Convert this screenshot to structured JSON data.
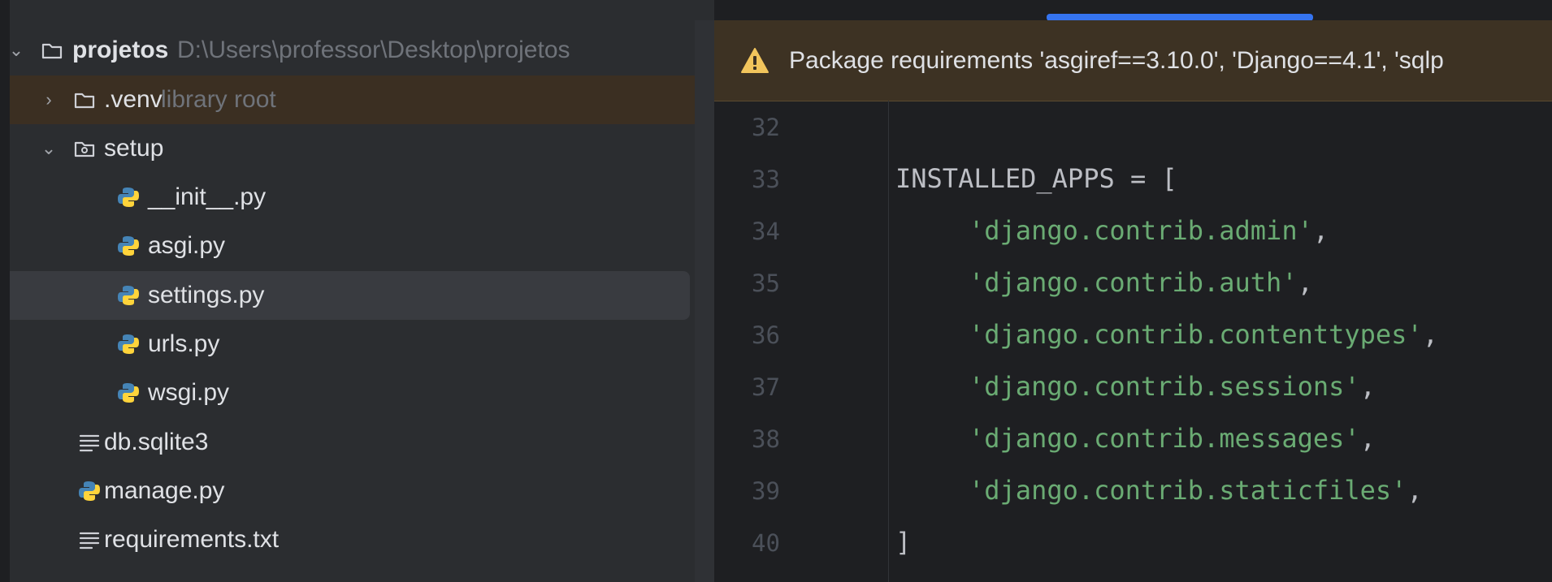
{
  "project": {
    "root": {
      "name": "projetos",
      "path": "D:\\Users\\professor\\Desktop\\projetos"
    },
    "venv": {
      "name": ".venv",
      "hint": "library root"
    },
    "setup": {
      "name": "setup",
      "files": [
        "__init__.py",
        "asgi.py",
        "settings.py",
        "urls.py",
        "wsgi.py"
      ]
    },
    "root_files": [
      "db.sqlite3",
      "manage.py",
      "requirements.txt"
    ],
    "selected": "settings.py"
  },
  "banner": {
    "message": "Package requirements 'asgiref==3.10.0', 'Django==4.1', 'sqlp"
  },
  "editor": {
    "lines": [
      {
        "n": "32",
        "code": ""
      },
      {
        "n": "33",
        "code": "INSTALLED_APPS = ["
      },
      {
        "n": "34",
        "str": "'django.contrib.admin'",
        "tail": ","
      },
      {
        "n": "35",
        "str": "'django.contrib.auth'",
        "tail": ","
      },
      {
        "n": "36",
        "str": "'django.contrib.contenttypes'",
        "tail": ","
      },
      {
        "n": "37",
        "str": "'django.contrib.sessions'",
        "tail": ","
      },
      {
        "n": "38",
        "str": "'django.contrib.messages'",
        "tail": ","
      },
      {
        "n": "39",
        "str": "'django.contrib.staticfiles'",
        "tail": ","
      },
      {
        "n": "40",
        "code": "]"
      }
    ]
  },
  "colors": {
    "accent": "#3574f0",
    "string": "#6aab73",
    "warning": "#f2c55c",
    "venv_highlight": "#3b2f22"
  }
}
